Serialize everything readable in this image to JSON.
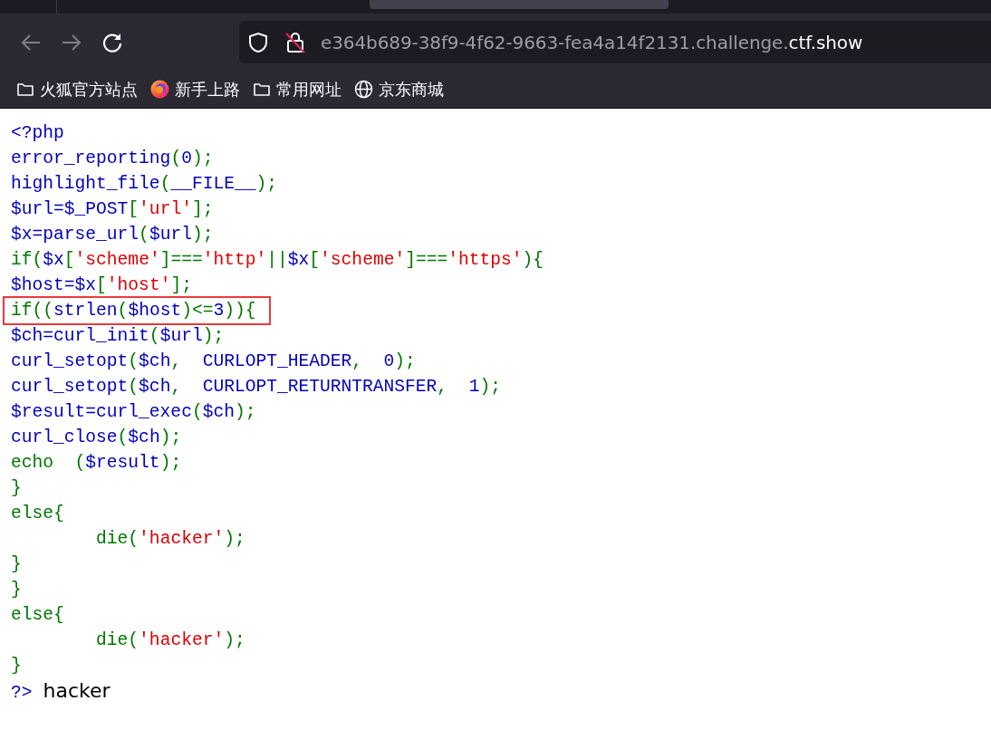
{
  "toolbar": {
    "url": {
      "host_prefix": "e364b689-38f9-4f62-9663-fea4a14f2131.challenge.",
      "domain": "ctf.show"
    }
  },
  "bookmarks": [
    {
      "kind": "folder",
      "label": "火狐官方站点"
    },
    {
      "kind": "firefox",
      "label": "新手上路"
    },
    {
      "kind": "folder",
      "label": "常用网址"
    },
    {
      "kind": "globe",
      "label": "京东商城"
    }
  ],
  "code_lines": [
    {
      "boxed": false,
      "tokens": [
        {
          "kind": "default",
          "text": "<?php"
        }
      ]
    },
    {
      "boxed": false,
      "tokens": [
        {
          "kind": "default",
          "text": "error_reporting"
        },
        {
          "kind": "keyword",
          "text": "("
        },
        {
          "kind": "default",
          "text": "0"
        },
        {
          "kind": "keyword",
          "text": ");"
        }
      ]
    },
    {
      "boxed": false,
      "tokens": [
        {
          "kind": "default",
          "text": "highlight_file"
        },
        {
          "kind": "keyword",
          "text": "("
        },
        {
          "kind": "default",
          "text": "__FILE__"
        },
        {
          "kind": "keyword",
          "text": ");"
        }
      ]
    },
    {
      "boxed": false,
      "tokens": [
        {
          "kind": "default",
          "text": "$url=$_POST"
        },
        {
          "kind": "keyword",
          "text": "["
        },
        {
          "kind": "string",
          "text": "'url'"
        },
        {
          "kind": "keyword",
          "text": "];"
        }
      ]
    },
    {
      "boxed": false,
      "tokens": [
        {
          "kind": "default",
          "text": "$x=parse_url"
        },
        {
          "kind": "keyword",
          "text": "("
        },
        {
          "kind": "default",
          "text": "$url"
        },
        {
          "kind": "keyword",
          "text": ");"
        }
      ]
    },
    {
      "boxed": false,
      "tokens": [
        {
          "kind": "keyword",
          "text": "if("
        },
        {
          "kind": "default",
          "text": "$x"
        },
        {
          "kind": "keyword",
          "text": "["
        },
        {
          "kind": "string",
          "text": "'scheme'"
        },
        {
          "kind": "keyword",
          "text": "]==="
        },
        {
          "kind": "string",
          "text": "'http'"
        },
        {
          "kind": "keyword",
          "text": "||"
        },
        {
          "kind": "default",
          "text": "$x"
        },
        {
          "kind": "keyword",
          "text": "["
        },
        {
          "kind": "string",
          "text": "'scheme'"
        },
        {
          "kind": "keyword",
          "text": "]==="
        },
        {
          "kind": "string",
          "text": "'https'"
        },
        {
          "kind": "keyword",
          "text": "){"
        }
      ]
    },
    {
      "boxed": false,
      "tokens": [
        {
          "kind": "default",
          "text": "$host=$x"
        },
        {
          "kind": "keyword",
          "text": "["
        },
        {
          "kind": "string",
          "text": "'host'"
        },
        {
          "kind": "keyword",
          "text": "];"
        }
      ]
    },
    {
      "boxed": true,
      "tokens": [
        {
          "kind": "keyword",
          "text": "if(("
        },
        {
          "kind": "default",
          "text": "strlen"
        },
        {
          "kind": "keyword",
          "text": "("
        },
        {
          "kind": "default",
          "text": "$host"
        },
        {
          "kind": "keyword",
          "text": ")<="
        },
        {
          "kind": "default",
          "text": "3"
        },
        {
          "kind": "keyword",
          "text": ")){"
        }
      ]
    },
    {
      "boxed": false,
      "tokens": [
        {
          "kind": "default",
          "text": "$ch=curl_init"
        },
        {
          "kind": "keyword",
          "text": "("
        },
        {
          "kind": "default",
          "text": "$url"
        },
        {
          "kind": "keyword",
          "text": ");"
        }
      ]
    },
    {
      "boxed": false,
      "tokens": [
        {
          "kind": "default",
          "text": "curl_setopt"
        },
        {
          "kind": "keyword",
          "text": "("
        },
        {
          "kind": "default",
          "text": "$ch"
        },
        {
          "kind": "keyword",
          "text": ",  "
        },
        {
          "kind": "default",
          "text": "CURLOPT_HEADER"
        },
        {
          "kind": "keyword",
          "text": ",  "
        },
        {
          "kind": "default",
          "text": "0"
        },
        {
          "kind": "keyword",
          "text": ");"
        }
      ]
    },
    {
      "boxed": false,
      "tokens": [
        {
          "kind": "default",
          "text": "curl_setopt"
        },
        {
          "kind": "keyword",
          "text": "("
        },
        {
          "kind": "default",
          "text": "$ch"
        },
        {
          "kind": "keyword",
          "text": ",  "
        },
        {
          "kind": "default",
          "text": "CURLOPT_RETURNTRANSFER"
        },
        {
          "kind": "keyword",
          "text": ",  "
        },
        {
          "kind": "default",
          "text": "1"
        },
        {
          "kind": "keyword",
          "text": ");"
        }
      ]
    },
    {
      "boxed": false,
      "tokens": [
        {
          "kind": "default",
          "text": "$result=curl_exec"
        },
        {
          "kind": "keyword",
          "text": "("
        },
        {
          "kind": "default",
          "text": "$ch"
        },
        {
          "kind": "keyword",
          "text": ");"
        }
      ]
    },
    {
      "boxed": false,
      "tokens": [
        {
          "kind": "default",
          "text": "curl_close"
        },
        {
          "kind": "keyword",
          "text": "("
        },
        {
          "kind": "default",
          "text": "$ch"
        },
        {
          "kind": "keyword",
          "text": ");"
        }
      ]
    },
    {
      "boxed": false,
      "tokens": [
        {
          "kind": "keyword",
          "text": "echo  ("
        },
        {
          "kind": "default",
          "text": "$result"
        },
        {
          "kind": "keyword",
          "text": ");"
        }
      ]
    },
    {
      "boxed": false,
      "tokens": [
        {
          "kind": "keyword",
          "text": "}"
        }
      ]
    },
    {
      "boxed": false,
      "tokens": [
        {
          "kind": "keyword",
          "text": "else{"
        }
      ]
    },
    {
      "boxed": false,
      "tokens": [
        {
          "kind": "keyword",
          "text": "        die("
        },
        {
          "kind": "string",
          "text": "'hacker'"
        },
        {
          "kind": "keyword",
          "text": ");"
        }
      ]
    },
    {
      "boxed": false,
      "tokens": [
        {
          "kind": "keyword",
          "text": "}"
        }
      ]
    },
    {
      "boxed": false,
      "tokens": [
        {
          "kind": "keyword",
          "text": "}"
        }
      ]
    },
    {
      "boxed": false,
      "tokens": [
        {
          "kind": "keyword",
          "text": "else{"
        }
      ]
    },
    {
      "boxed": false,
      "tokens": [
        {
          "kind": "keyword",
          "text": "        die("
        },
        {
          "kind": "string",
          "text": "'hacker'"
        },
        {
          "kind": "keyword",
          "text": ");"
        }
      ]
    },
    {
      "boxed": false,
      "tokens": [
        {
          "kind": "keyword",
          "text": "}"
        }
      ]
    },
    {
      "boxed": false,
      "tokens": [
        {
          "kind": "default",
          "text": "?>"
        }
      ]
    }
  ],
  "output": "hacker"
}
